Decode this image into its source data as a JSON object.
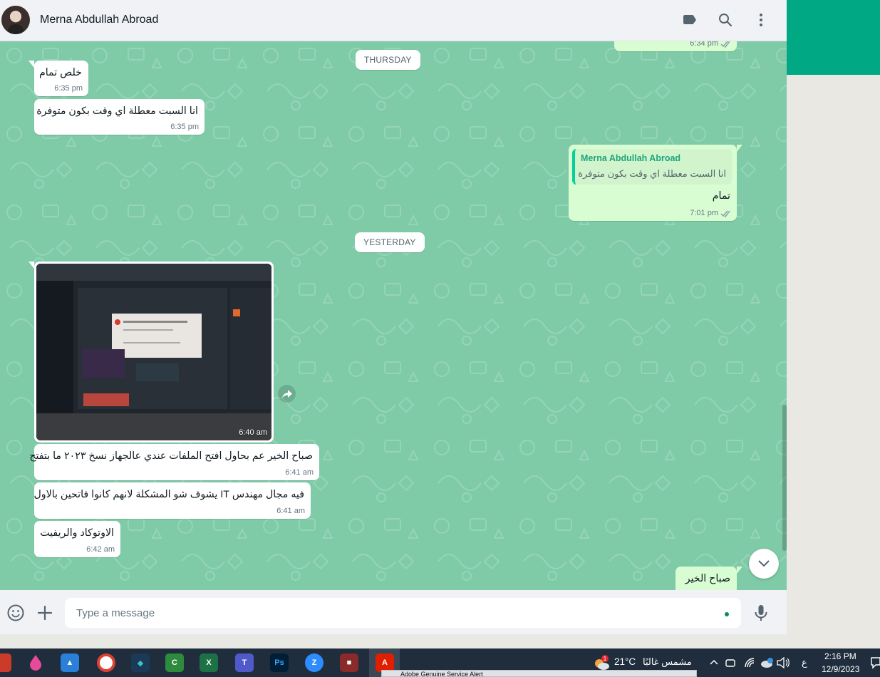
{
  "header": {
    "contact_name": "Merna Abdullah Abroad",
    "icons": [
      "label-icon",
      "search-icon",
      "menu-icon"
    ]
  },
  "chat": {
    "days": [
      "THURSDAY",
      "YESTERDAY"
    ],
    "messages": [
      {
        "dir": "out",
        "text": "",
        "time": "6:34 pm",
        "status": "read"
      },
      {
        "dir": "in",
        "text": "خلص تمام",
        "time": "6:35 pm"
      },
      {
        "dir": "in",
        "text": "انا السبت معطلة اي وقت بكون متوفرة",
        "time": "6:35 pm"
      },
      {
        "dir": "out",
        "quote_author": "Merna Abdullah Abroad",
        "quote_text": "انا السبت معطلة اي وقت بكون متوفرة",
        "text": "تمام",
        "time": "7:01 pm",
        "status": "read"
      },
      {
        "dir": "in",
        "type": "image",
        "time": "6:40 am"
      },
      {
        "dir": "in",
        "text": "صباح الخير عم بحاول افتح الملفات عندي عالجهاز نسخ ٢٠٢٣ ما بتفتح",
        "time": "6:41 am"
      },
      {
        "dir": "in",
        "text": "فيه مجال مهندس IT يشوف شو المشكلة لانهم كانوا فاتحين بالاول",
        "time": "6:41 am"
      },
      {
        "dir": "in",
        "text": "الاوتوكاد والريفيت",
        "time": "6:42 am"
      },
      {
        "dir": "out",
        "text": "صباح الخير",
        "time": ""
      }
    ]
  },
  "composer": {
    "placeholder": "Type a message",
    "icons": [
      "emoji-icon",
      "attach-plus-icon",
      "microphone-icon"
    ]
  },
  "taskbar": {
    "weather_temp": "21°C",
    "weather_text": "مشمس غالبًا",
    "weather_badge": "1",
    "lang": "ع",
    "time": "2:16 PM",
    "date": "12/9/2023",
    "preview_title": "Adobe Genuine Service Alert"
  },
  "colors": {
    "chat_bg": "#7fcba8",
    "incoming_bubble": "#ffffff",
    "outgoing_bubble": "#d9fdd3",
    "accent": "#00a884"
  }
}
